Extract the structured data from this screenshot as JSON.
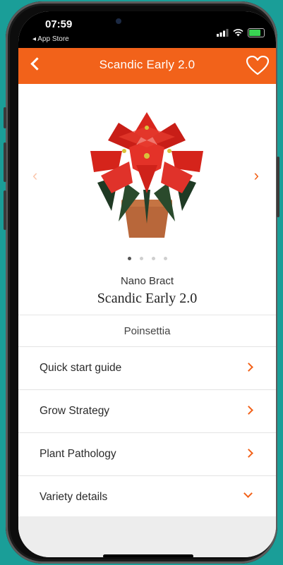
{
  "status_bar": {
    "time": "07:59",
    "back_to_app": "◂ App Store"
  },
  "header": {
    "title": "Scandic Early 2.0",
    "back_icon": "chevron-left-icon",
    "favorite_icon": "heart-icon",
    "background_color": "#f2621a"
  },
  "carousel": {
    "image": "red poinsettia plant in terracotta pot",
    "prev_icon": "chevron-left-icon",
    "next_icon": "chevron-right-icon",
    "page_count": 4,
    "active_page": 1
  },
  "product": {
    "series": "Nano Bract",
    "variety": "Scandic Early 2.0",
    "category": "Poinsettia"
  },
  "menu": {
    "items": [
      {
        "label": "Quick start guide",
        "icon": "chevron-right-icon"
      },
      {
        "label": "Grow Strategy",
        "icon": "chevron-right-icon"
      },
      {
        "label": "Plant Pathology",
        "icon": "chevron-right-icon"
      },
      {
        "label": "Variety details",
        "icon": "chevron-down-icon"
      }
    ]
  },
  "colors": {
    "accent": "#f2621a",
    "background": "#1a9e98"
  }
}
